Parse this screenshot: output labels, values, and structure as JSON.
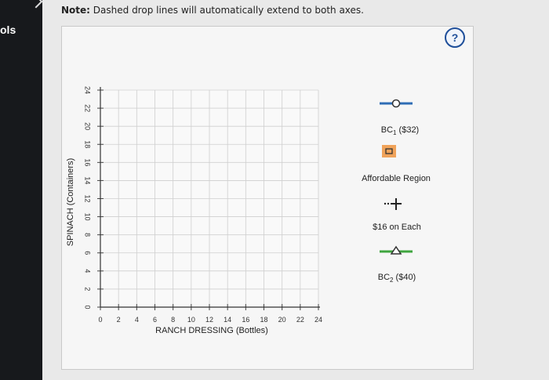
{
  "app": {
    "tools_label": "ols"
  },
  "note": {
    "prefix": "Note:",
    "text": "Dashed drop lines will automatically extend to both axes."
  },
  "help": {
    "label": "?"
  },
  "graph": {
    "y_axis_label": "SPINACH (Containers)",
    "x_axis_label": "RANCH DRESSING (Bottles)",
    "y_ticks": [
      "0",
      "2",
      "4",
      "6",
      "8",
      "10",
      "12",
      "14",
      "16",
      "18",
      "20",
      "22",
      "24"
    ],
    "x_ticks": [
      "0",
      "2",
      "4",
      "6",
      "8",
      "10",
      "12",
      "14",
      "16",
      "18",
      "20",
      "22",
      "24"
    ]
  },
  "legend": {
    "bc1_label": "BC",
    "bc1_sub": "1",
    "bc1_value": " ($32)",
    "affordable_label": "Affordable Region",
    "each_label": "$16 on Each",
    "bc2_label": "BC",
    "bc2_sub": "2",
    "bc2_value": " ($40)",
    "colors": {
      "bc1_line": "#2f6db5",
      "region_fill": "#f0a35a",
      "bc2_line": "#3fa53f",
      "plus": "#222222"
    }
  }
}
